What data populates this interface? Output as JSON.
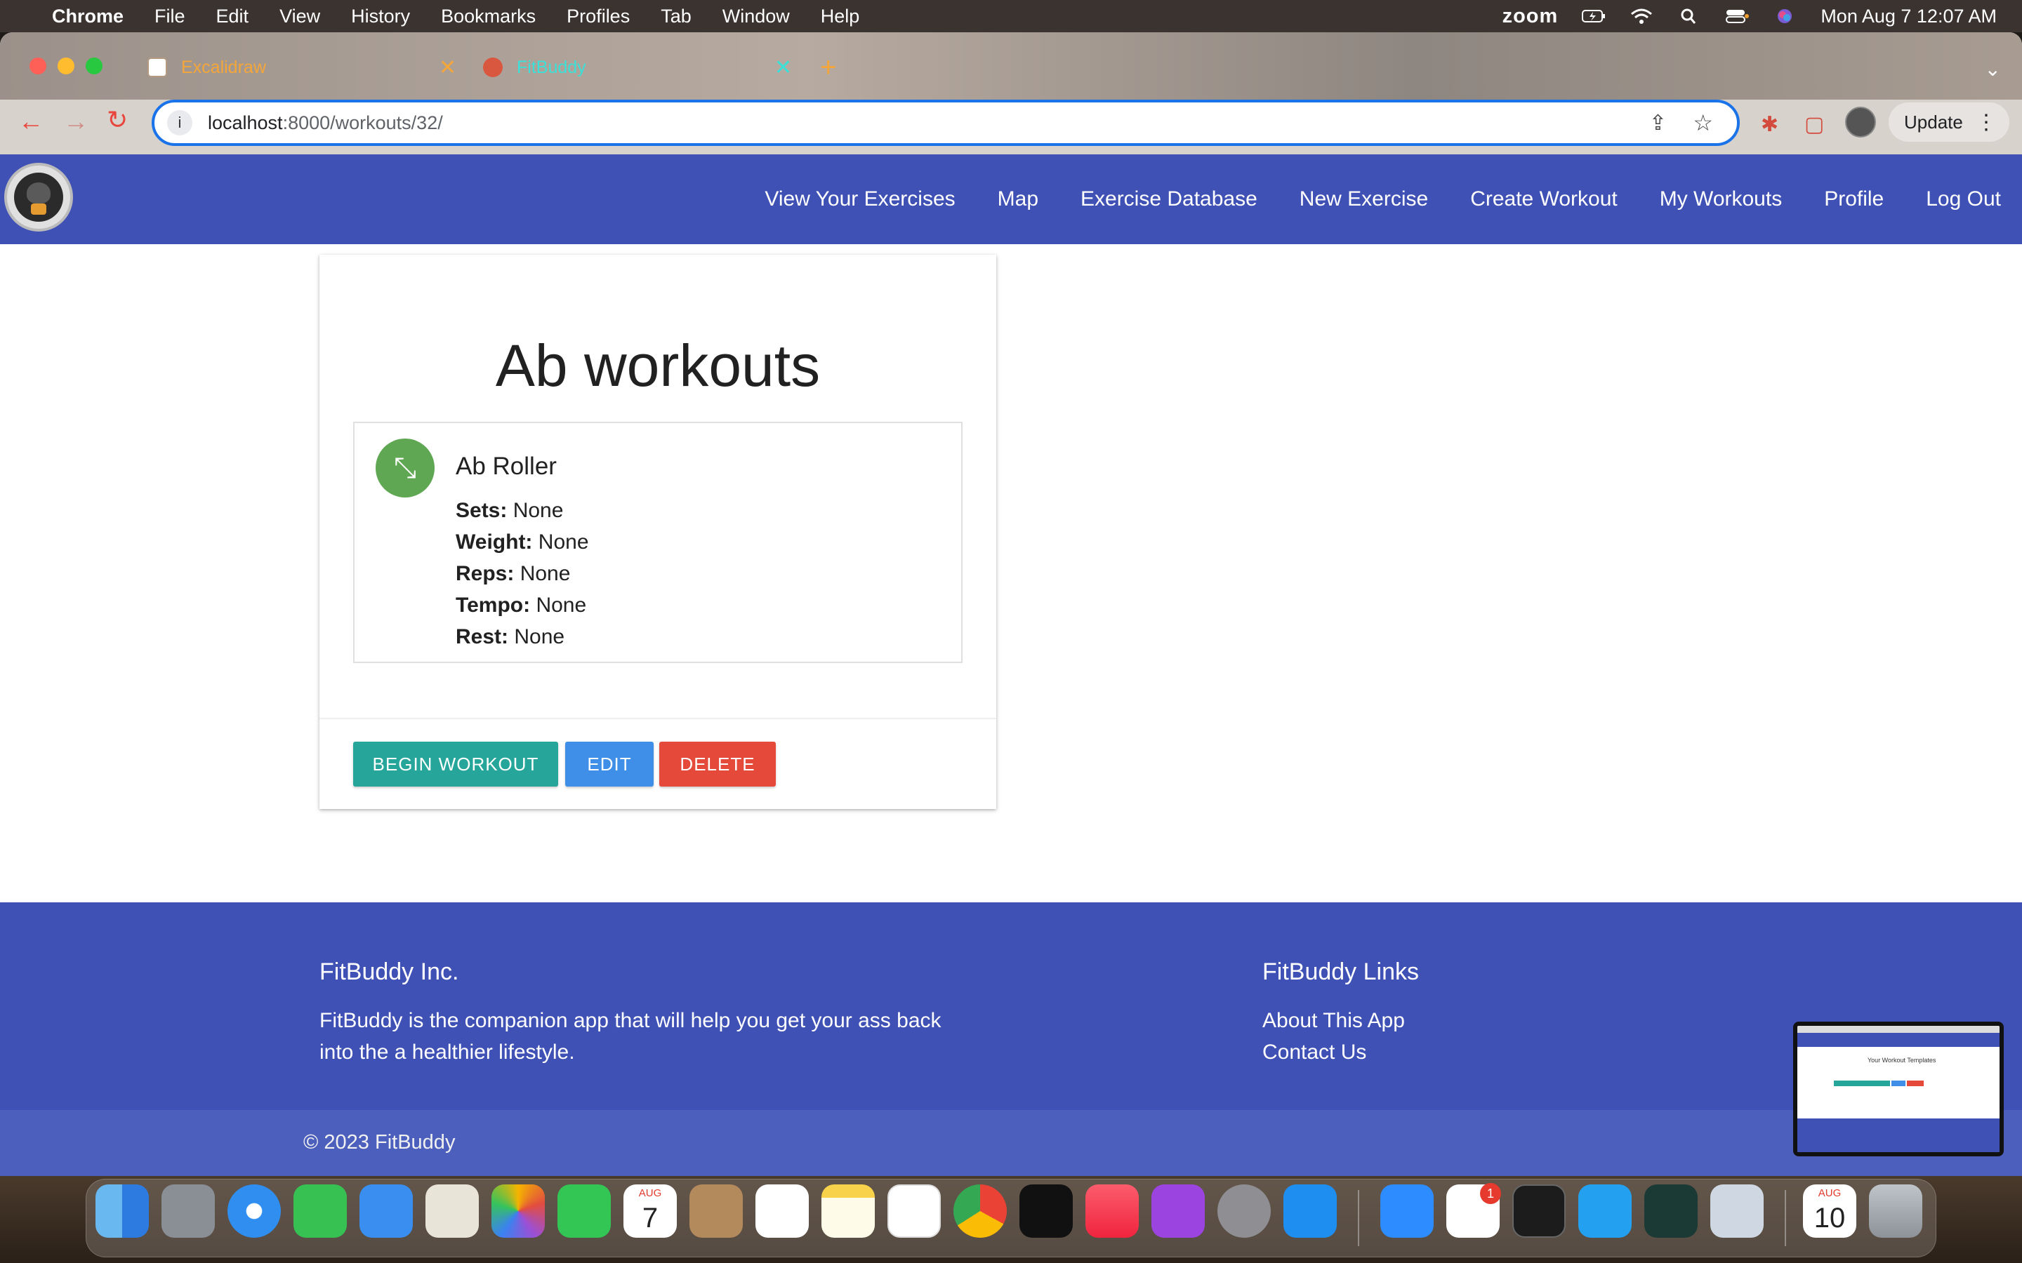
{
  "menubar": {
    "app": "Chrome",
    "items": [
      "File",
      "Edit",
      "View",
      "History",
      "Bookmarks",
      "Profiles",
      "Tab",
      "Window",
      "Help"
    ],
    "zoom": "zoom",
    "datetime": "Mon Aug 7  12:07 AM"
  },
  "browser": {
    "tabs": [
      {
        "title": "Excalidraw"
      },
      {
        "title": "FitBuddy"
      }
    ],
    "url_host": "localhost",
    "url_rest": ":8000/workouts/32/",
    "update_label": "Update"
  },
  "navbar": {
    "links": [
      "View Your Exercises",
      "Map",
      "Exercise Database",
      "New Exercise",
      "Create Workout",
      "My Workouts",
      "Profile",
      "Log Out"
    ]
  },
  "workout": {
    "title": "Ab workouts",
    "exercise": {
      "name": "Ab Roller",
      "sets_label": "Sets:",
      "sets": "None",
      "weight_label": "Weight:",
      "weight": "None",
      "reps_label": "Reps:",
      "reps": "None",
      "tempo_label": "Tempo:",
      "tempo": "None",
      "rest_label": "Rest:",
      "rest": "None"
    },
    "buttons": {
      "begin": "BEGIN WORKOUT",
      "edit": "EDIT",
      "delete": "DELETE"
    }
  },
  "footer": {
    "company_title": "FitBuddy Inc.",
    "about_line1": "FitBuddy is the companion app that will help you get your ass back",
    "about_line2": "into the a healthier lifestyle.",
    "links_title": "FitBuddy Links",
    "link_about": "About This App",
    "link_contact": "Contact Us",
    "copyright": "© 2023 FitBuddy"
  },
  "thumbnail": {
    "title": "Your Workout Templates"
  },
  "dock": {
    "calendar_month": "AUG",
    "calendar_day": "7",
    "calendar2_month": "AUG",
    "calendar2_day": "10",
    "slack_badge": "1"
  },
  "colors": {
    "primary": "#3f51b5",
    "begin": "#26a69a",
    "edit": "#3f8fe8",
    "delete": "#e4493a",
    "exercise_icon": "#5fa752"
  }
}
